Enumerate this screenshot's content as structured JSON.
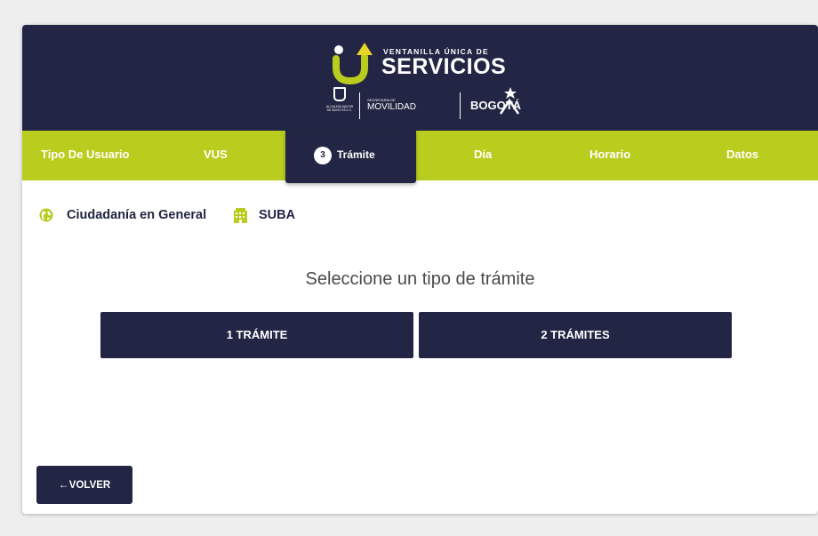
{
  "brand": {
    "line_small": "VENTANILLA ÚNICA DE",
    "line_big": "SERVICIOS",
    "shield_caption": "ALCALDÍA MAYOR\nDE BOGOTÁ D.C.",
    "secretaria_small": "SECRETARÍA DE",
    "secretaria_big": "MOVILIDAD",
    "city": "BOGOTÁ"
  },
  "steps": {
    "items": [
      "Tipo De Usuario",
      "VUS",
      "Trámite",
      "Día",
      "Horario",
      "Datos"
    ],
    "active_number": "3",
    "active_label": "Trámite"
  },
  "info": {
    "user_type": "Ciudadanía en General",
    "location": "SUBA"
  },
  "main": {
    "question": "Seleccione un tipo de trámite",
    "option_1": "1 TRÁMITE",
    "option_2": "2 TRÁMITES"
  },
  "footer": {
    "back_arrow": "←",
    "back_label": "VOLVER"
  },
  "colors": {
    "navy": "#222543",
    "lime": "#b9cd1e",
    "logo_yellow": "#e8d52a",
    "logo_green": "#b9cd1e"
  },
  "icons": {
    "globe": "globe-icon",
    "building": "building-icon"
  }
}
